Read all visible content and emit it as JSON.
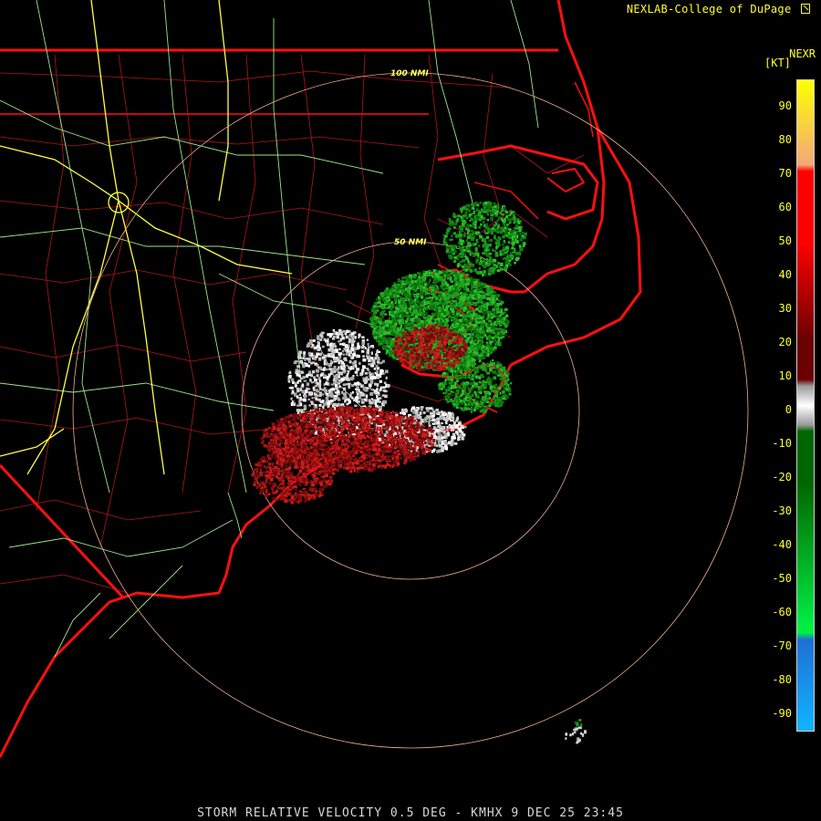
{
  "header": {
    "credit": "NEXLAB-College of DuPage",
    "product": "NEXR"
  },
  "colorbar": {
    "unit": "[KT]",
    "ticks": [
      "90",
      "80",
      "70",
      "60",
      "50",
      "40",
      "30",
      "20",
      "10",
      "0",
      "-10",
      "-20",
      "-30",
      "-40",
      "-50",
      "-60",
      "-70",
      "-80",
      "-90"
    ],
    "colors": {
      "yellow": "#ffff00",
      "peach": "#f4a77a",
      "red": "#ff0000",
      "dark_red": "#6a0000",
      "gray": "#9a9a9a",
      "dark_green": "#006600",
      "green": "#00ee44",
      "blue": "#1f6fd6",
      "light_blue": "#12b4ff"
    }
  },
  "map": {
    "range_rings": [
      "100 NMI",
      "50 NMI"
    ],
    "colors": {
      "state_borders": "#ff1010",
      "county_lines": "#b01818",
      "interstates": "#ffff40",
      "highways": "#9ce58c",
      "range_rings": "#f0b090",
      "inbound_velocity": "#20a020",
      "outbound_velocity": "#b01414",
      "near_zero_velocity": "#cfcfcf"
    }
  },
  "footer": {
    "caption": "STORM RELATIVE VELOCITY 0.5 DEG - KMHX 9 DEC 25 23:45"
  }
}
